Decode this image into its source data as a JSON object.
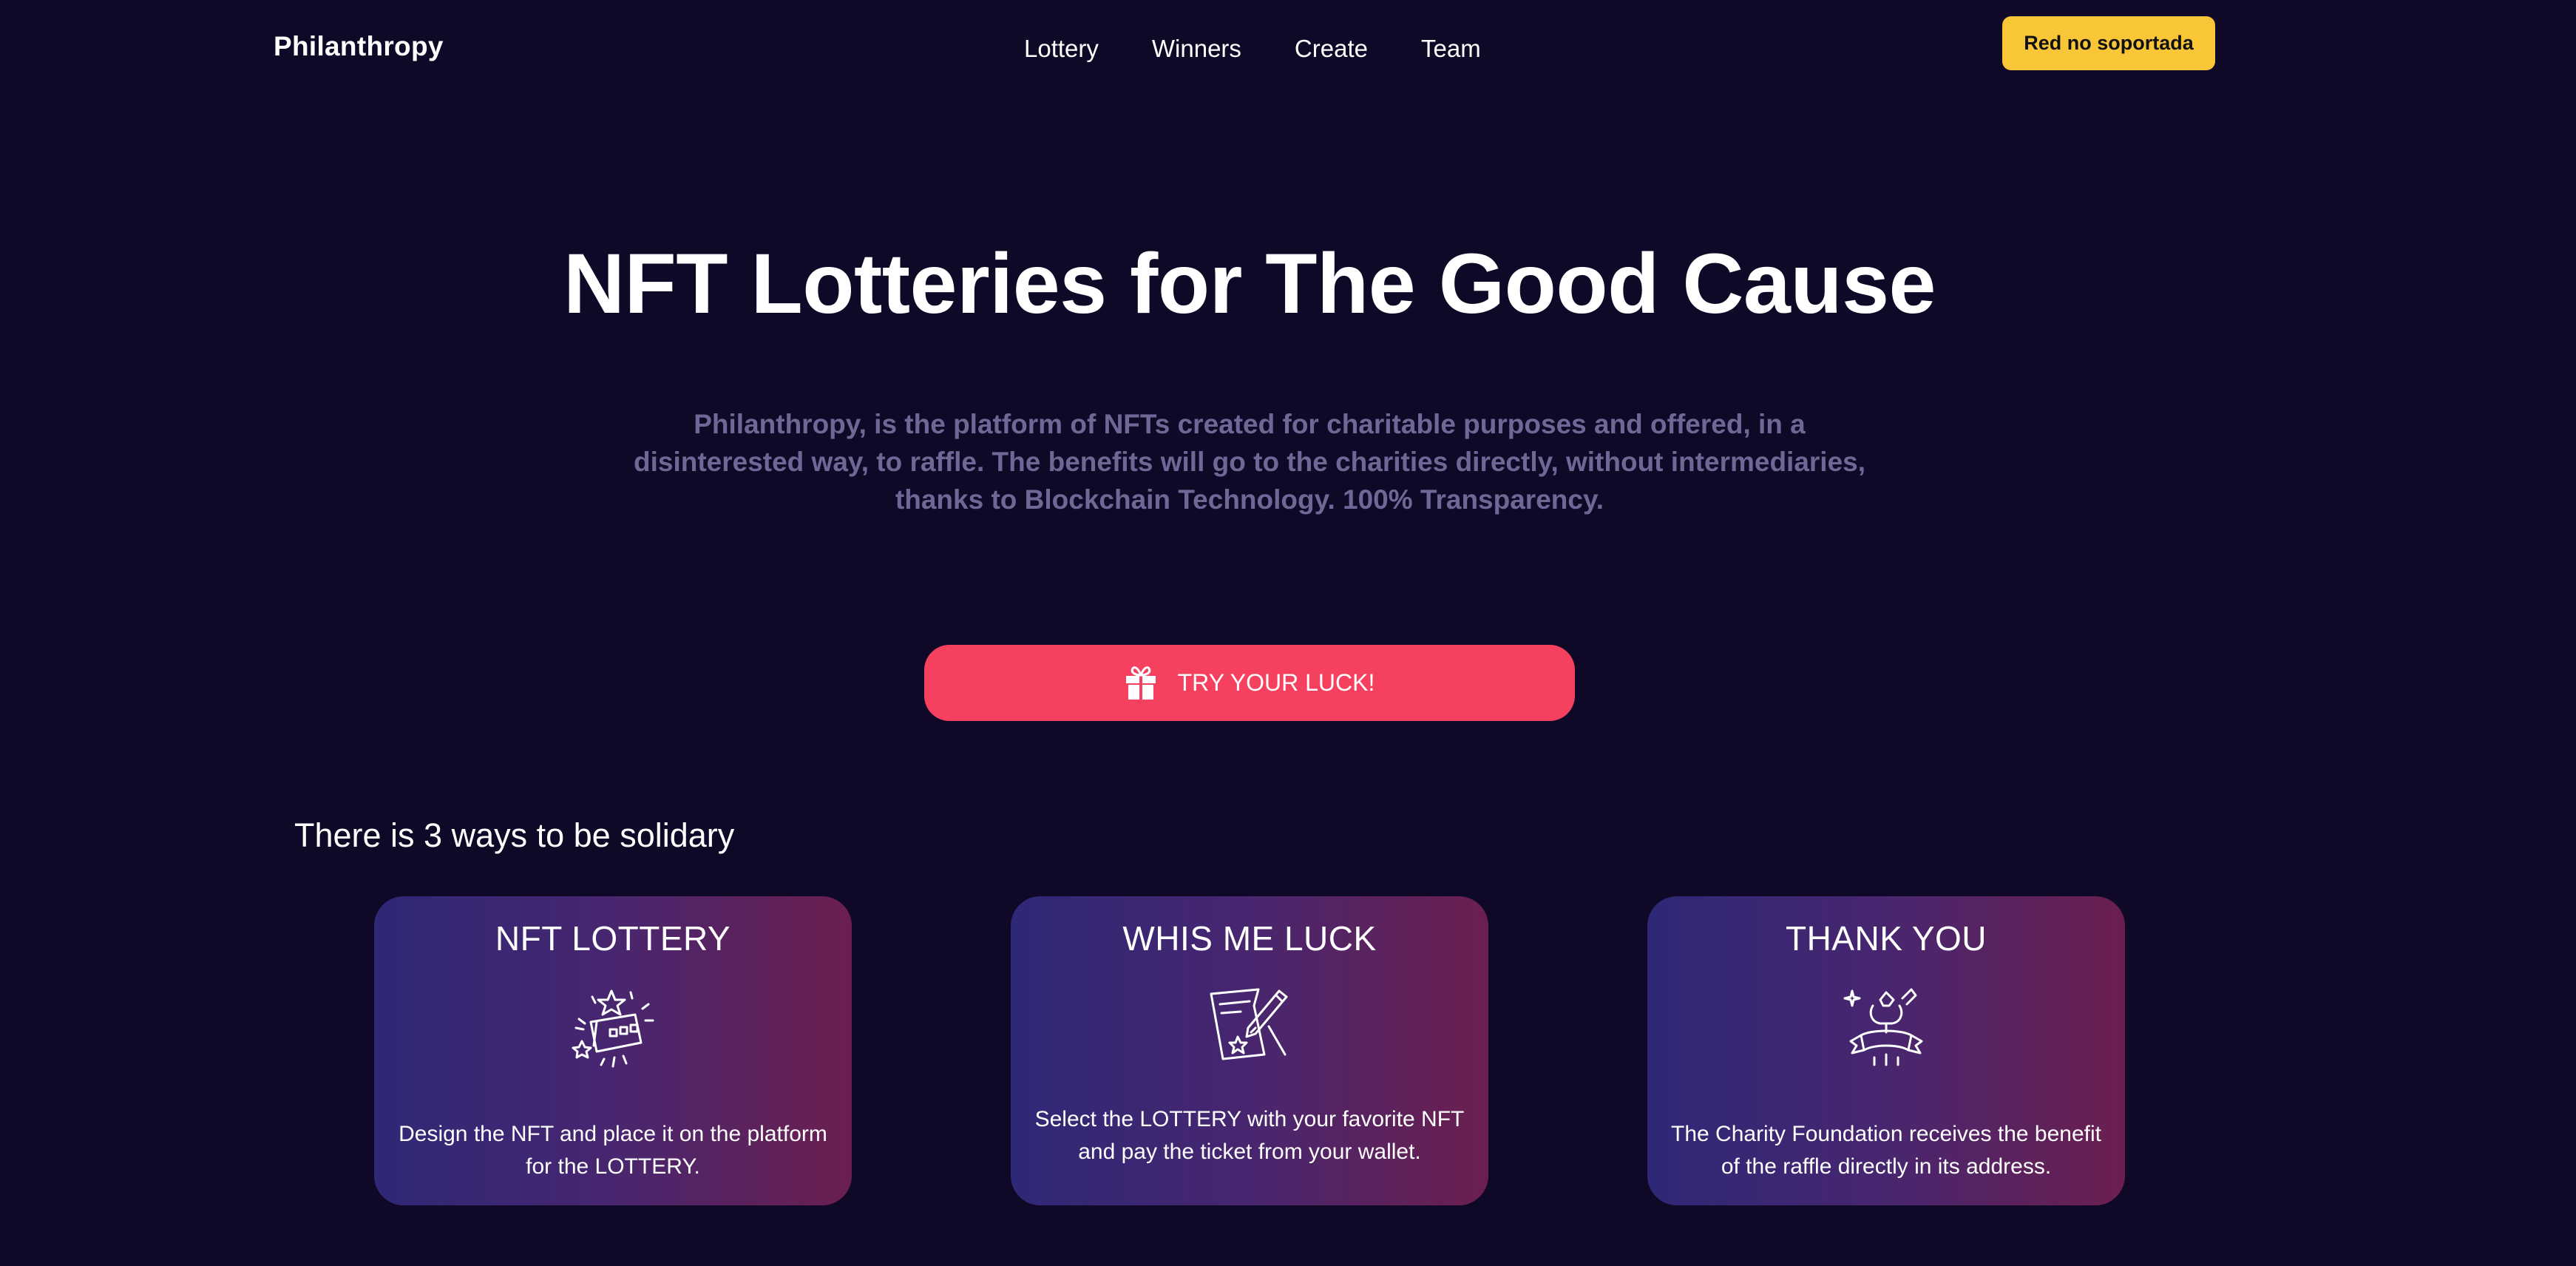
{
  "nav": {
    "brand": "Philanthropy",
    "items": [
      "Lottery",
      "Winners",
      "Create",
      "Team"
    ],
    "network_button": "Red no soportada"
  },
  "hero": {
    "title": "NFT Lotteries for The Good Cause",
    "description": "Philanthropy, is the platform of NFTs created for charitable purposes and offered, in a disinterested way, to raffle. The benefits will go to the charities directly, without intermediaries, thanks to Blockchain Technology. 100% Transparency.",
    "cta_label": "TRY YOUR LUCK!",
    "cta_icon": "gift-icon"
  },
  "ways": {
    "title": "There is 3 ways to be solidary",
    "cards": [
      {
        "title": "NFT LOTTERY",
        "icon": "lottery-ticket-icon",
        "text": "Design the NFT and place it on the platform for the LOTTERY."
      },
      {
        "title": "WHIS ME LUCK",
        "icon": "ticket-signing-icon",
        "text": "Select the LOTTERY with your favorite NFT and pay the ticket from your wallet."
      },
      {
        "title": "THANK YOU",
        "icon": "celebration-icon",
        "text": "The Charity Foundation receives the benefit of the raffle directly in its address."
      }
    ]
  },
  "colors": {
    "background": "#0f0827",
    "accent_yellow": "#f9c637",
    "accent_pink": "#f5405f",
    "muted_text": "#6f6896",
    "card_gradient_start": "#2e2877",
    "card_gradient_end": "#6b1f4f"
  }
}
